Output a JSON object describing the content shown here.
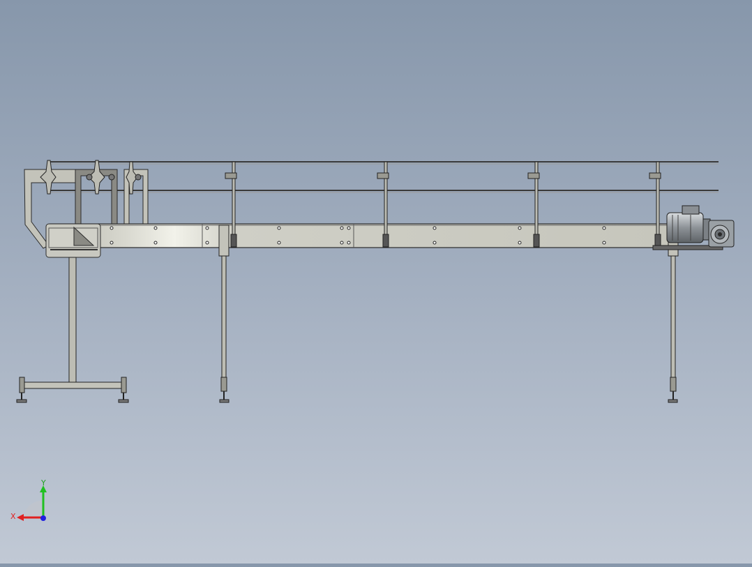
{
  "viewport": {
    "background_top": "#8797ab",
    "background_bottom": "#c1c9d5",
    "model_name": "conveyor-side-view"
  },
  "triad": {
    "x_label": "X",
    "y_label": "Y",
    "x_color": "#e02020",
    "y_color": "#20c020",
    "z_color": "#2020e0"
  },
  "model_colors": {
    "frame_fill": "#c9c9c0",
    "frame_edge": "#2b2b2b",
    "rail": "#3a3a3a",
    "motor": "#8a8f94"
  }
}
